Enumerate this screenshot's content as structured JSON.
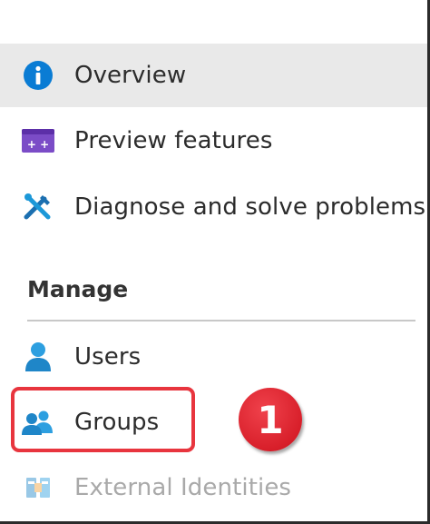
{
  "nav": {
    "items": [
      {
        "label": "Overview",
        "icon": "info-icon"
      },
      {
        "label": "Preview features",
        "icon": "preview-features-icon"
      },
      {
        "label": "Diagnose and solve problems",
        "icon": "tools-icon"
      }
    ]
  },
  "manage": {
    "title": "Manage",
    "items": [
      {
        "label": "Users",
        "icon": "user-icon"
      },
      {
        "label": "Groups",
        "icon": "groups-icon"
      },
      {
        "label": "External Identities",
        "icon": "external-identities-icon"
      }
    ]
  },
  "annotation": {
    "callout_number": "1"
  },
  "colors": {
    "selected_bg": "#e9e9e9",
    "highlight": "#e8353e",
    "accent_blue": "#0a7cd4"
  }
}
